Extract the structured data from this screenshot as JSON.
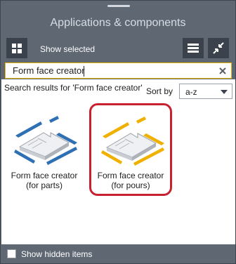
{
  "window": {
    "title": "Applications & components"
  },
  "toolbar": {
    "grid_icon": "grid-icon",
    "show_selected_label": "Show selected",
    "list_icon": "list-icon",
    "collapse_icon": "collapse-icon"
  },
  "search": {
    "value": "Form face creator",
    "clear_icon": "close-icon"
  },
  "results": {
    "label": "Search results for 'Form face creator'",
    "sort_by_label": "Sort by",
    "sort_value": "a-z"
  },
  "items": [
    {
      "label_line1": "Form face creator",
      "label_line2": "(for parts)",
      "color": "#2f6fb3",
      "selected": false
    },
    {
      "label_line1": "Form face creator",
      "label_line2": "(for pours)",
      "color": "#f0b000",
      "selected": true
    }
  ],
  "footer": {
    "show_hidden_label": "Show hidden items"
  },
  "colors": {
    "accent_selected": "#c8202f",
    "search_border": "#e4b400"
  }
}
